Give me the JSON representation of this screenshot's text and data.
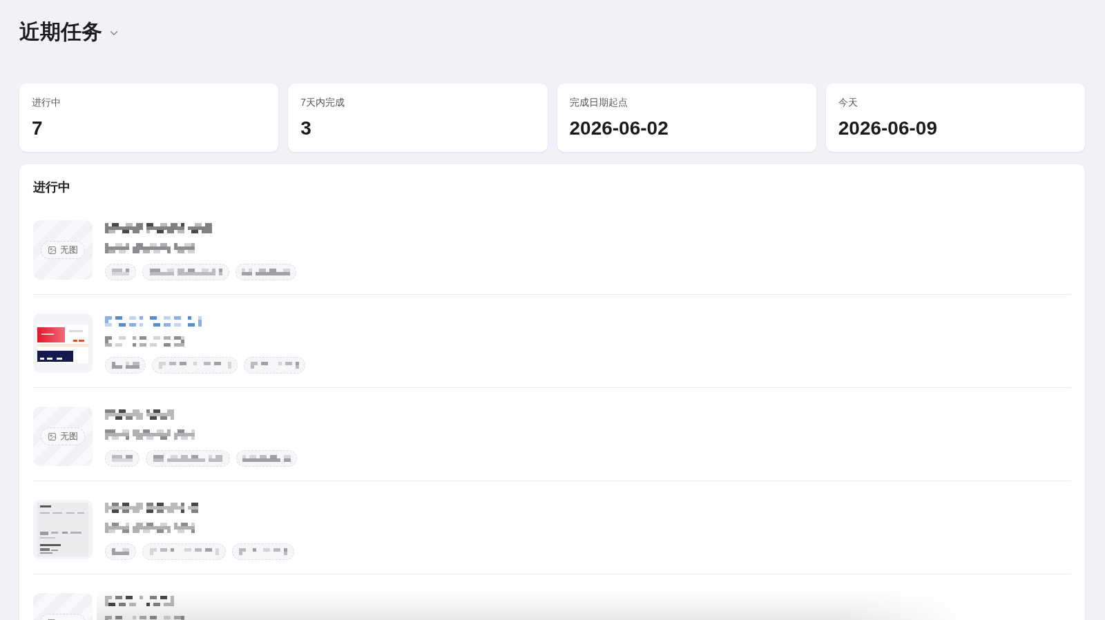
{
  "header": {
    "title": "近期任务",
    "dropdown": true
  },
  "stats": [
    {
      "label": "进行中",
      "value": "7"
    },
    {
      "label": "7天内完成",
      "value": "3"
    },
    {
      "label": "完成日期起点",
      "value": "2026-06-02"
    },
    {
      "label": "今天",
      "value": "2026-06-09"
    }
  ],
  "in_progress": {
    "title": "进行中",
    "tasks": [
      {
        "thumbnail": {
          "kind": "placeholder",
          "label": "无图"
        },
        "title_link": false
      },
      {
        "thumbnail": {
          "kind": "banner"
        },
        "title_link": true
      },
      {
        "thumbnail": {
          "kind": "placeholder",
          "label": "无图"
        },
        "title_link": false
      },
      {
        "thumbnail": {
          "kind": "document"
        },
        "title_link": false
      },
      {
        "thumbnail": {
          "kind": "placeholder"
        },
        "title_link": false
      }
    ]
  }
}
